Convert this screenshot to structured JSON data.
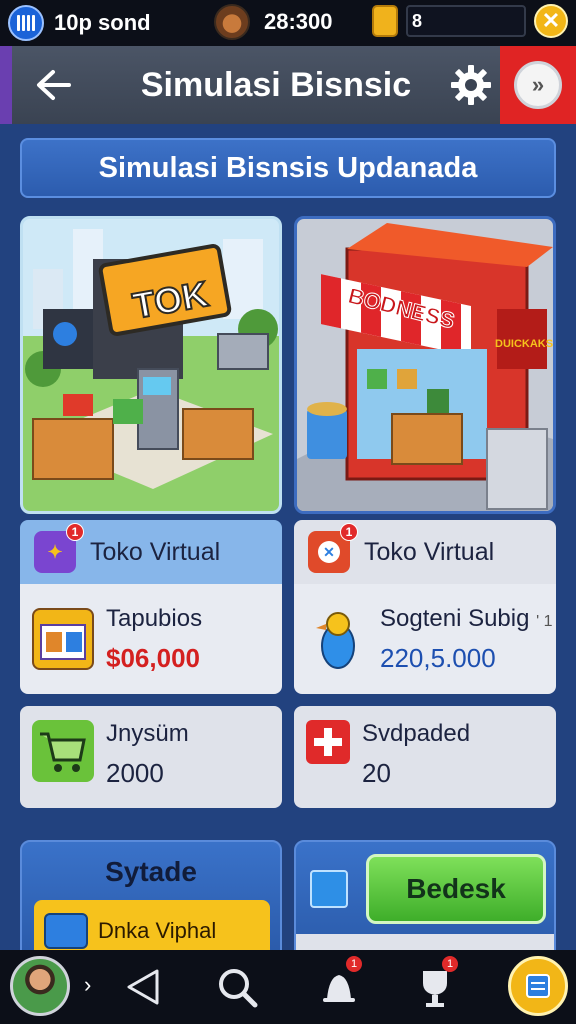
{
  "status_bar": {
    "carrier": "10p sond",
    "time": "28:300",
    "field_value": "8"
  },
  "header": {
    "title": "Simulasi Bisnsic"
  },
  "banner": {
    "text": "Simulasi Bisnsis Updanada"
  },
  "cards": [
    {
      "image_sign": "TOK",
      "tab_label": "Toko Virtual",
      "tab_badge": "1",
      "stat1_label": "Tapubios",
      "stat1_value": "$06,000",
      "stat2_label": "Jnysüm",
      "stat2_value": "2000"
    },
    {
      "image_sign": "BODNESS",
      "image_side_sign": "DUICKAKS",
      "tab_label": "Toko Virtual",
      "tab_badge": "1",
      "stat1_label": "Sogteni Subig",
      "stat1_suffix": "' 1",
      "stat1_value": "220,5.000",
      "stat2_label": "Svdpaded",
      "stat2_value": "20"
    }
  ],
  "system_card": {
    "title": "Sytade",
    "sub_label": "Dnka Viphal"
  },
  "action_card": {
    "button_label": "Bedesk"
  },
  "nav": {
    "dot_label": "›",
    "badge_1": "1",
    "badge_2": "1"
  },
  "colors": {
    "background": "#22427f",
    "header": "#3a4352",
    "accent_red": "#e02424",
    "accent_green": "#3fae2a",
    "accent_yellow": "#f2b617",
    "value_red": "#d42020",
    "value_blue": "#1d4fb0"
  },
  "icons": [
    "signal-icon",
    "back-arrow-icon",
    "gear-icon",
    "fast-forward-icon",
    "close-icon",
    "shopping-cart-icon",
    "medical-plus-icon",
    "triangle-back-icon",
    "search-icon",
    "bell-icon",
    "trophy-icon",
    "home-menu-icon"
  ]
}
